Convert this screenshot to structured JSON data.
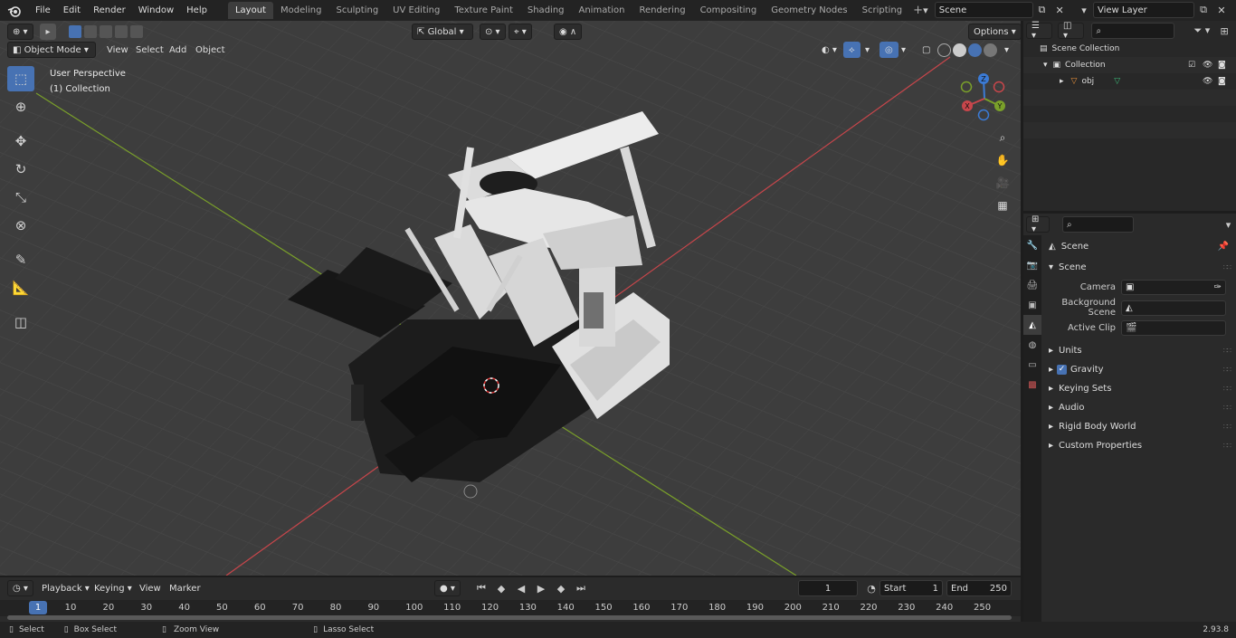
{
  "menu": {
    "items": [
      "File",
      "Edit",
      "Render",
      "Window",
      "Help"
    ]
  },
  "workspaces": {
    "active": "Layout",
    "tabs": [
      "Layout",
      "Modeling",
      "Sculpting",
      "UV Editing",
      "Texture Paint",
      "Shading",
      "Animation",
      "Rendering",
      "Compositing",
      "Geometry Nodes",
      "Scripting"
    ]
  },
  "scene": {
    "name": "Scene"
  },
  "view_layer": {
    "name": "View Layer"
  },
  "viewport": {
    "transform": "Global",
    "options_label": "Options",
    "mode": "Object Mode",
    "menus": [
      "View",
      "Select",
      "Add",
      "Object"
    ],
    "overlay_line1": "User Perspective",
    "overlay_line2": "(1) Collection",
    "gizmo": {
      "x": "X",
      "y": "Y",
      "z": "Z"
    }
  },
  "outliner": {
    "scene_collection": "Scene Collection",
    "collection": "Collection",
    "object": "obj"
  },
  "properties": {
    "header": "Scene",
    "section": "Scene",
    "camera_label": "Camera",
    "background_label": "Background Scene",
    "active_clip_label": "Active Clip",
    "panels": [
      "Units",
      "Gravity",
      "Keying Sets",
      "Audio",
      "Rigid Body World",
      "Custom Properties"
    ]
  },
  "timeline": {
    "menus": [
      "Playback",
      "Keying",
      "View",
      "Marker"
    ],
    "current_frame": "1",
    "start_label": "Start",
    "start": "1",
    "end_label": "End",
    "end": "250",
    "ruler": [
      "1",
      "10",
      "20",
      "30",
      "40",
      "50",
      "60",
      "70",
      "80",
      "90",
      "100",
      "110",
      "120",
      "130",
      "140",
      "150",
      "160",
      "170",
      "180",
      "190",
      "200",
      "210",
      "220",
      "230",
      "240",
      "250"
    ]
  },
  "status": {
    "select": "Select",
    "box_select": "Box Select",
    "zoom_view": "Zoom View",
    "lasso_select": "Lasso Select",
    "version": "2.93.8"
  },
  "colors": {
    "accent": "#4772b3",
    "x_axis": "#c8464b",
    "y_axis": "#7aa02a",
    "z_axis": "#3b7bd6"
  }
}
